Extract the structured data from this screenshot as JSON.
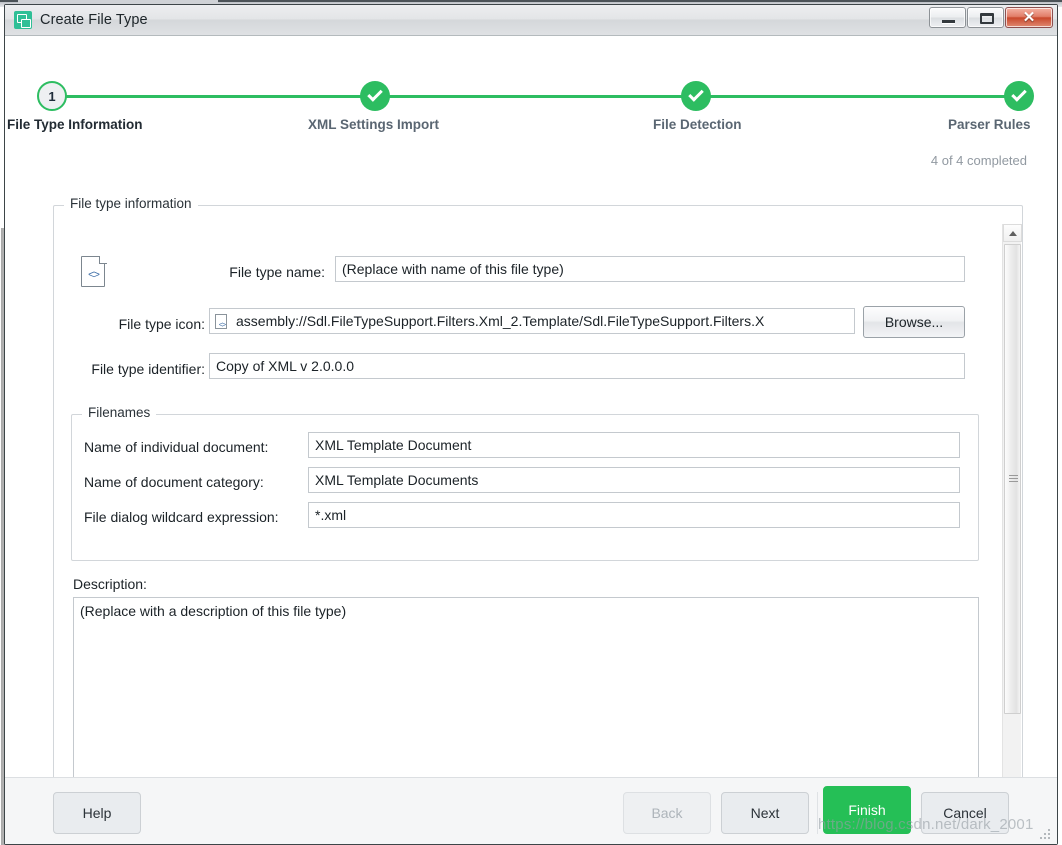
{
  "window": {
    "title": "Create File Type",
    "icon": "file-type-icon",
    "buttons": {
      "minimize": "minimize-icon",
      "maximize": "maximize-icon",
      "close": "✕"
    }
  },
  "wizard": {
    "completed_note": "4 of 4 completed",
    "steps": [
      {
        "label": "File Type Information",
        "state": "current",
        "marker": "1"
      },
      {
        "label": "XML Settings Import",
        "state": "done",
        "marker": "check-icon"
      },
      {
        "label": "File Detection",
        "state": "done",
        "marker": "check-icon"
      },
      {
        "label": "Parser Rules",
        "state": "done",
        "marker": "check-icon"
      }
    ]
  },
  "form": {
    "group_title": "File type information",
    "file_type_icon": "xml-document-icon",
    "file_type_name": {
      "label": "File type name:",
      "value": "(Replace with name of this file type)"
    },
    "file_type_icon_field": {
      "label": "File type icon:",
      "value": "assembly://Sdl.FileTypeSupport.Filters.Xml_2.Template/Sdl.FileTypeSupport.Filters.X",
      "browse_label": "Browse..."
    },
    "file_type_identifier": {
      "label": "File type identifier:",
      "value": "Copy of XML v 2.0.0.0"
    },
    "filenames": {
      "group_title": "Filenames",
      "fields": [
        {
          "label": "Name of individual document:",
          "value": "XML Template Document"
        },
        {
          "label": "Name of document category:",
          "value": "XML Template Documents"
        },
        {
          "label": "File dialog wildcard expression:",
          "value": "*.xml"
        }
      ]
    },
    "description": {
      "label": "Description:",
      "value": "(Replace with a description of this file type)"
    }
  },
  "footer": {
    "help": "Help",
    "back": "Back",
    "next": "Next",
    "finish": "Finish",
    "cancel": "Cancel"
  },
  "watermark": {
    "text": "https://blog.csdn.net/dark_2001"
  },
  "colors": {
    "accent_green": "#2dbd61",
    "finish_green": "#25bf56",
    "title_icon_green": "#2fbf96",
    "step_label": "#5a6672"
  }
}
